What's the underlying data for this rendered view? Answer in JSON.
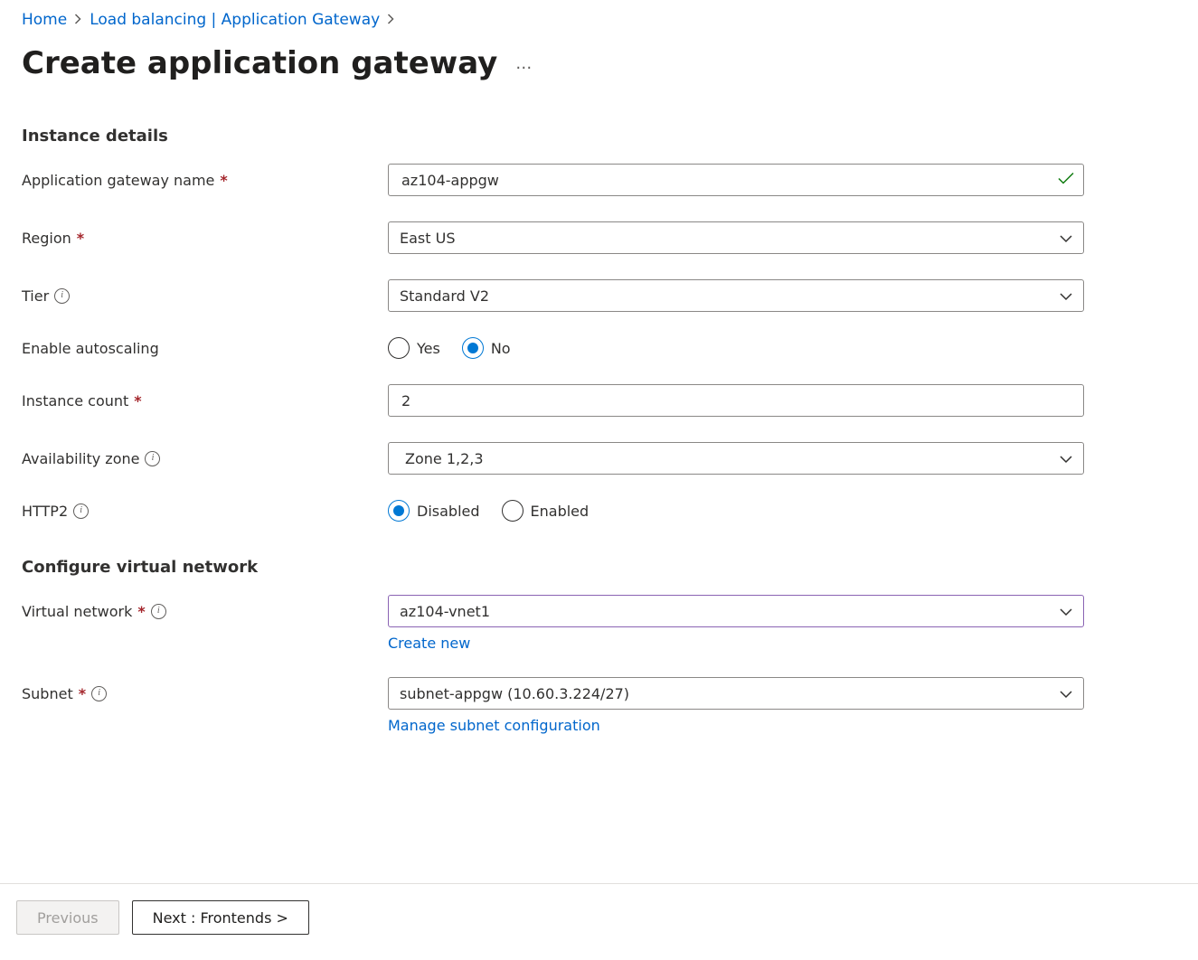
{
  "breadcrumb": {
    "home": "Home",
    "load_balancing": "Load balancing | Application Gateway"
  },
  "page_title": "Create application gateway",
  "section_instance": {
    "title": "Instance details",
    "gateway_name_label": "Application gateway name",
    "gateway_name_value": "az104-appgw",
    "region_label": "Region",
    "region_value": "East US",
    "tier_label": "Tier",
    "tier_value": "Standard V2",
    "autoscaling_label": "Enable autoscaling",
    "autoscaling_yes": "Yes",
    "autoscaling_no": "No",
    "autoscaling_selected": "No",
    "instance_count_label": "Instance count",
    "instance_count_value": "2",
    "az_label": "Availability zone",
    "az_value": "Zone 1,2,3",
    "http2_label": "HTTP2",
    "http2_disabled": "Disabled",
    "http2_enabled": "Enabled",
    "http2_selected": "Disabled"
  },
  "section_vnet": {
    "title": "Configure virtual network",
    "vnet_label": "Virtual network",
    "vnet_value": "az104-vnet1",
    "vnet_create_new": "Create new",
    "subnet_label": "Subnet",
    "subnet_value": "subnet-appgw (10.60.3.224/27)",
    "subnet_manage": "Manage subnet configuration"
  },
  "footer": {
    "previous": "Previous",
    "next": "Next : Frontends >"
  }
}
